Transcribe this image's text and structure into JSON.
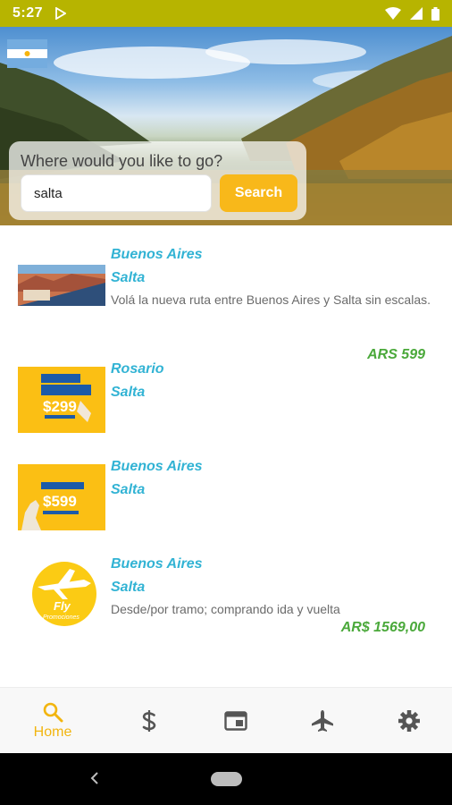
{
  "status_bar": {
    "time": "5:27"
  },
  "search": {
    "title": "Where would you like to go?",
    "value": "salta",
    "button_label": "Search"
  },
  "offers": [
    {
      "origin": "Buenos Aires",
      "destination": "Salta",
      "description": "Volá la nueva ruta entre Buenos Aires y Salta sin escalas.",
      "price": "ARS 599"
    },
    {
      "origin": "Rosario",
      "destination": "Salta",
      "description": "",
      "price": ""
    },
    {
      "origin": "Buenos Aires",
      "destination": "Salta",
      "description": "",
      "price": ""
    },
    {
      "origin": "Buenos Aires",
      "destination": "Salta",
      "description": "Desde/por tramo; comprando ida y vuelta",
      "price": "AR$ 1569,00"
    }
  ],
  "thumbnails": {
    "promo_2_price": "$299",
    "promo_3_price": "$599",
    "logo_line1": "Fly",
    "logo_line2": "Promociones"
  },
  "nav": {
    "items": [
      {
        "label": "Home",
        "icon": "search-icon",
        "active": true
      },
      {
        "label": "",
        "icon": "dollar-icon",
        "active": false
      },
      {
        "label": "",
        "icon": "window-icon",
        "active": false
      },
      {
        "label": "",
        "icon": "airplane-icon",
        "active": false
      },
      {
        "label": "",
        "icon": "gear-icon",
        "active": false
      }
    ]
  },
  "colors": {
    "status_bar": "#b7b400",
    "accent_yellow": "#f8b81a",
    "city_blue": "#32b3d4",
    "price_green": "#4ba93b"
  }
}
